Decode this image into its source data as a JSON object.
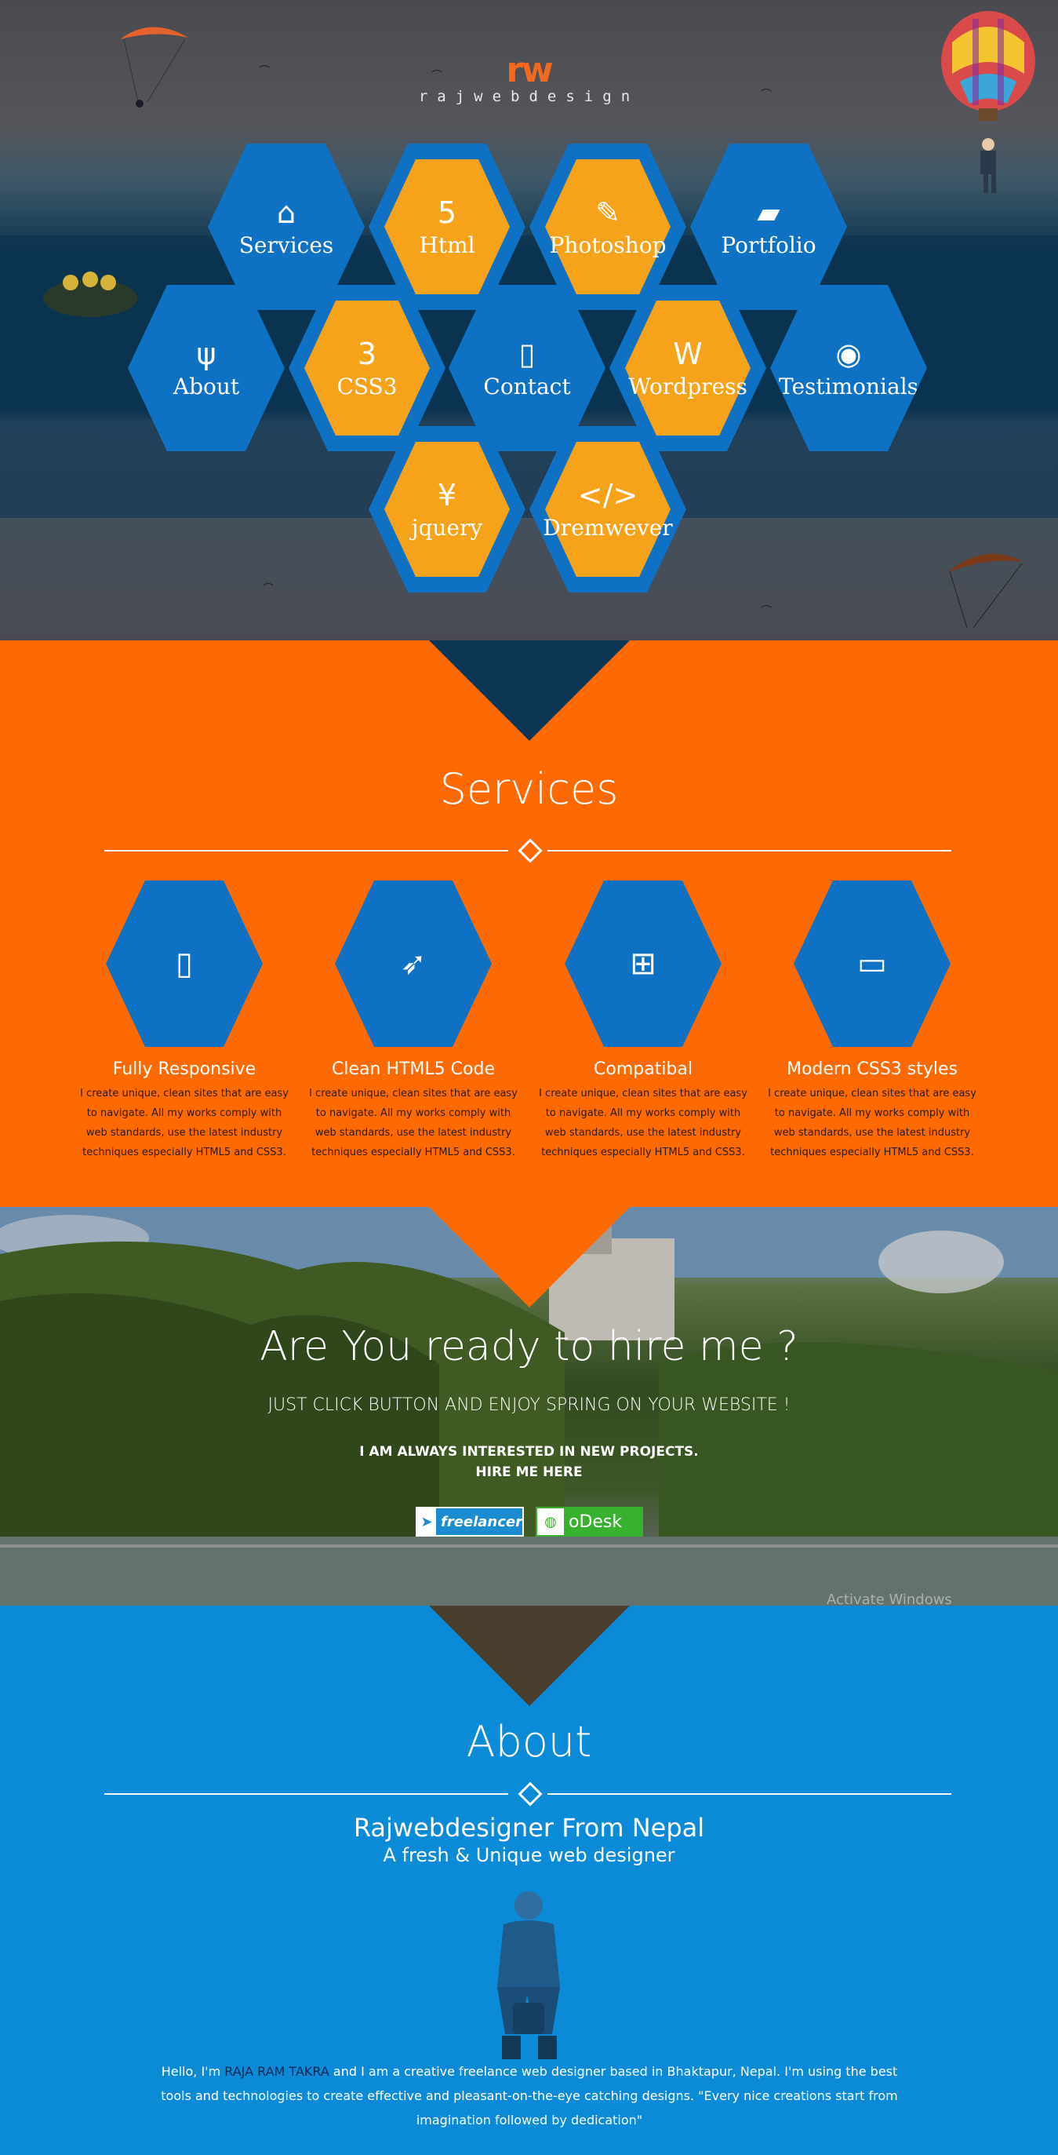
{
  "logo": {
    "mark": "rw",
    "text": "rajwebdesign"
  },
  "hero_menu": [
    {
      "label": "Services",
      "icon": "home-icon",
      "glyph": "⌂",
      "style": "blue"
    },
    {
      "label": "Html",
      "icon": "html5-icon",
      "glyph": "5",
      "style": "ring"
    },
    {
      "label": "Photoshop",
      "icon": "brush-icon",
      "glyph": "✎",
      "style": "ring"
    },
    {
      "label": "Portfolio",
      "icon": "folder-icon",
      "glyph": "▰",
      "style": "blue"
    },
    {
      "label": "About",
      "icon": "cutlery-icon",
      "glyph": "ψ",
      "style": "blue"
    },
    {
      "label": "CSS3",
      "icon": "css3-icon",
      "glyph": "3",
      "style": "ring"
    },
    {
      "label": "Contact",
      "icon": "mobile-icon",
      "glyph": "▯",
      "style": "blue"
    },
    {
      "label": "Wordpress",
      "icon": "wordpress-icon",
      "glyph": "W",
      "style": "ring"
    },
    {
      "label": "Testimonials",
      "icon": "bitbucket-icon",
      "glyph": "◉",
      "style": "blue"
    },
    {
      "label": "jquery",
      "icon": "yen-icon",
      "glyph": "¥",
      "style": "ring"
    },
    {
      "label": "Dremwever",
      "icon": "code-icon",
      "glyph": "</>",
      "style": "ring"
    }
  ],
  "services": {
    "title": "Services",
    "items": [
      {
        "title": "Fully Responsive",
        "icon": "mobile-icon",
        "glyph": "▯",
        "text": "I create unique, clean sites that are easy to navigate. All my works comply with web standards, use the latest industry techniques especially HTML5 and CSS3."
      },
      {
        "title": "Clean HTML5 Code",
        "icon": "rocket-icon",
        "glyph": "➶",
        "text": "I create unique, clean sites that are easy to navigate. All my works comply with web standards, use the latest industry techniques especially HTML5 and CSS3."
      },
      {
        "title": "Compatibal",
        "icon": "windows-icon",
        "glyph": "⊞",
        "text": "I create unique, clean sites that are easy to navigate. All my works comply with web standards, use the latest industry techniques especially HTML5 and CSS3."
      },
      {
        "title": "Modern CSS3 styles",
        "icon": "laptop-icon",
        "glyph": "▭",
        "text": "I create unique, clean sites that are easy to navigate. All my works comply with web standards, use the latest industry techniques especially HTML5 and CSS3."
      }
    ]
  },
  "hire": {
    "heading": "Are You ready to hire me ?",
    "subheading": "JUST CLICK BUTTON AND ENJOY SPRING ON YOUR WEBSITE !",
    "line1": "I AM ALWAYS INTERESTED IN NEW PROJECTS.",
    "line2": "HIRE ME HERE",
    "freelancer": "freelancer",
    "odesk": "oDesk",
    "watermark": "Activate Windows"
  },
  "about": {
    "title": "About",
    "name": "Rajwebdesigner From Nepal",
    "tagline": "A fresh & Unique web designer",
    "bio_pre": "Hello, I'm ",
    "bio_name": "RAJA RAM TAKRA",
    "bio_post": " and I am a creative freelance web designer based in Bhaktapur, Nepal. I'm using the best tools and technologies to create effective and pleasant-on-the-eye catching designs. \"Every nice creations start from imagination followed by dedication\""
  },
  "colors": {
    "orange": "#ff6a00",
    "blue": "#0f71c4",
    "about_bg": "#0b8ad8",
    "hex_orange": "#f7a21b"
  }
}
